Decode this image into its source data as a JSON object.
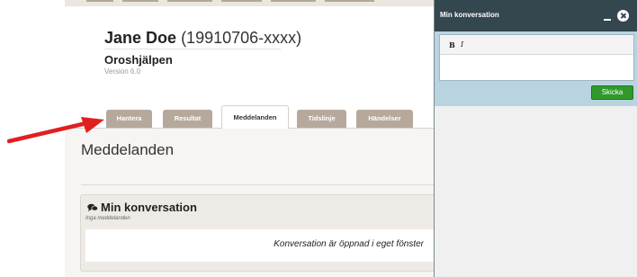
{
  "patient": {
    "name": "Jane Doe",
    "personnummer": "(19910706-xxxx)"
  },
  "app": {
    "title": "Oroshjälpen",
    "version": "Version 6.0"
  },
  "tabs": [
    {
      "label": "Hantera",
      "active": false
    },
    {
      "label": "Resultat",
      "active": false
    },
    {
      "label": "Meddelanden",
      "active": true
    },
    {
      "label": "Tidslinje",
      "active": false
    },
    {
      "label": "Händelser",
      "active": false
    }
  ],
  "page": {
    "heading": "Meddelanden"
  },
  "conversation": {
    "title": "Min konversation",
    "subtitle": "Inga meddelanden",
    "message": "Konversation är öppnad i eget fönster"
  },
  "window": {
    "title": "Min konversation",
    "toolbar": {
      "bold": "B",
      "italic": "I"
    },
    "send_label": "Skicka"
  },
  "colors": {
    "tab_inactive": "#b6a99c",
    "window_title_bg": "#34464e",
    "compose_bg": "#b9d3e0",
    "send_button": "#2f9a2b",
    "arrow": "#e02020"
  },
  "icons": [
    "chat-icon",
    "minimize-icon",
    "close-icon",
    "arrow-annotation"
  ]
}
